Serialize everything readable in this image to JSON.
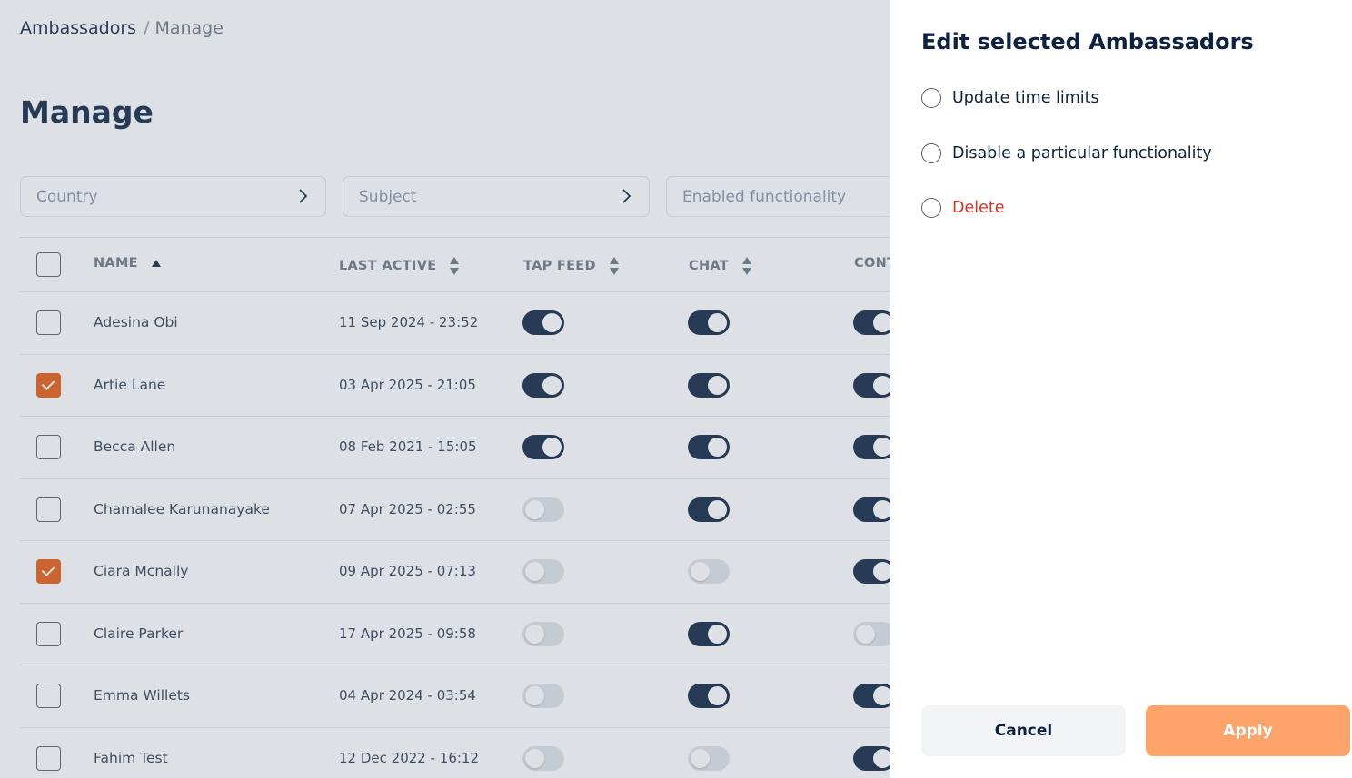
{
  "breadcrumb": {
    "root": "Ambassadors",
    "separator": "/",
    "current": "Manage"
  },
  "page_title": "Manage",
  "filters": [
    {
      "placeholder": "Country"
    },
    {
      "placeholder": "Subject"
    },
    {
      "placeholder": "Enabled functionality"
    }
  ],
  "table": {
    "columns": {
      "name": "NAME",
      "last_active": "LAST ACTIVE",
      "tap_feed": "TAP FEED",
      "chat": "CHAT",
      "content": "CONT"
    },
    "rows": [
      {
        "name": "Adesina Obi",
        "last_active": "11 Sep 2024 - 23:52",
        "selected": false,
        "tap_feed": true,
        "chat": true,
        "content": true
      },
      {
        "name": "Artie Lane",
        "last_active": "03 Apr 2025 - 21:05",
        "selected": true,
        "tap_feed": true,
        "chat": true,
        "content": true
      },
      {
        "name": "Becca Allen",
        "last_active": "08 Feb 2021 - 15:05",
        "selected": false,
        "tap_feed": true,
        "chat": true,
        "content": true
      },
      {
        "name": "Chamalee Karunanayake",
        "last_active": "07 Apr 2025 - 02:55",
        "selected": false,
        "tap_feed": false,
        "chat": true,
        "content": true
      },
      {
        "name": "Ciara Mcnally",
        "last_active": "09 Apr 2025 - 07:13",
        "selected": true,
        "tap_feed": false,
        "chat": false,
        "content": true
      },
      {
        "name": "Claire Parker",
        "last_active": "17 Apr 2025 - 09:58",
        "selected": false,
        "tap_feed": false,
        "chat": true,
        "content": false
      },
      {
        "name": "Emma Willets",
        "last_active": "04 Apr 2024 - 03:54",
        "selected": false,
        "tap_feed": false,
        "chat": true,
        "content": true
      },
      {
        "name": "Fahim Test",
        "last_active": "12 Dec 2022 - 16:12",
        "selected": false,
        "tap_feed": false,
        "chat": false,
        "content": true
      }
    ]
  },
  "drawer": {
    "title": "Edit selected Ambassadors",
    "options": {
      "update_time_limits": "Update time limits",
      "disable_functionality": "Disable a particular functionality",
      "delete": "Delete"
    },
    "cancel_label": "Cancel",
    "apply_label": "Apply"
  },
  "colors": {
    "primary": "#0d2240",
    "accent": "#e8590c",
    "apply_button": "#fda46b",
    "danger": "#d93025"
  }
}
